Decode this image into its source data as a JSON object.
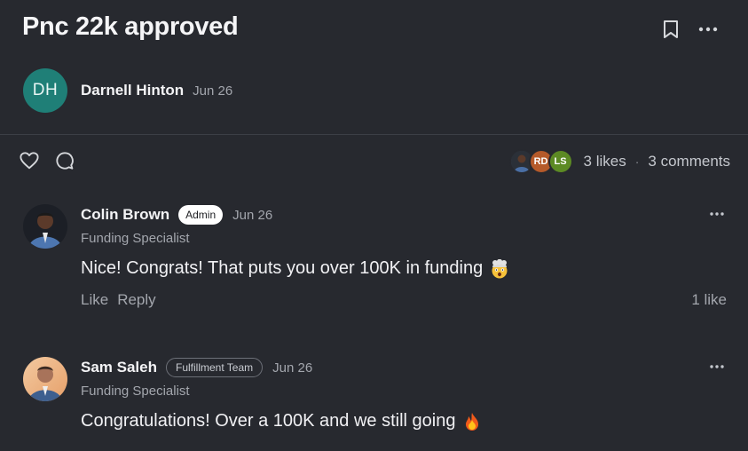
{
  "post": {
    "title": "Pnc 22k approved",
    "author": {
      "initials": "DH",
      "name": "Darnell Hinton",
      "date": "Jun 26"
    },
    "stats": {
      "likes": "3 likes",
      "comments": "3 comments",
      "liker_initials": [
        "RD",
        "LS"
      ]
    }
  },
  "comments": [
    {
      "name": "Colin Brown",
      "badge": "Admin",
      "date": "Jun 26",
      "role": "Funding Specialist",
      "text": "Nice! Congrats! That puts you over 100K in funding",
      "emoji": "exploding-head-icon",
      "like_label": "Like",
      "reply_label": "Reply",
      "likes": "1 like"
    },
    {
      "name": "Sam Saleh",
      "badge": "Fulfillment Team",
      "date": "Jun 26",
      "role": "Funding Specialist",
      "text": "Congratulations! Over a 100K and we still going",
      "emoji": "fire-icon"
    }
  ],
  "colors": {
    "background": "#27292f",
    "author_avatar": "#1f7f77",
    "rd_avatar": "#b55a2a",
    "ls_avatar": "#5c8a24"
  }
}
